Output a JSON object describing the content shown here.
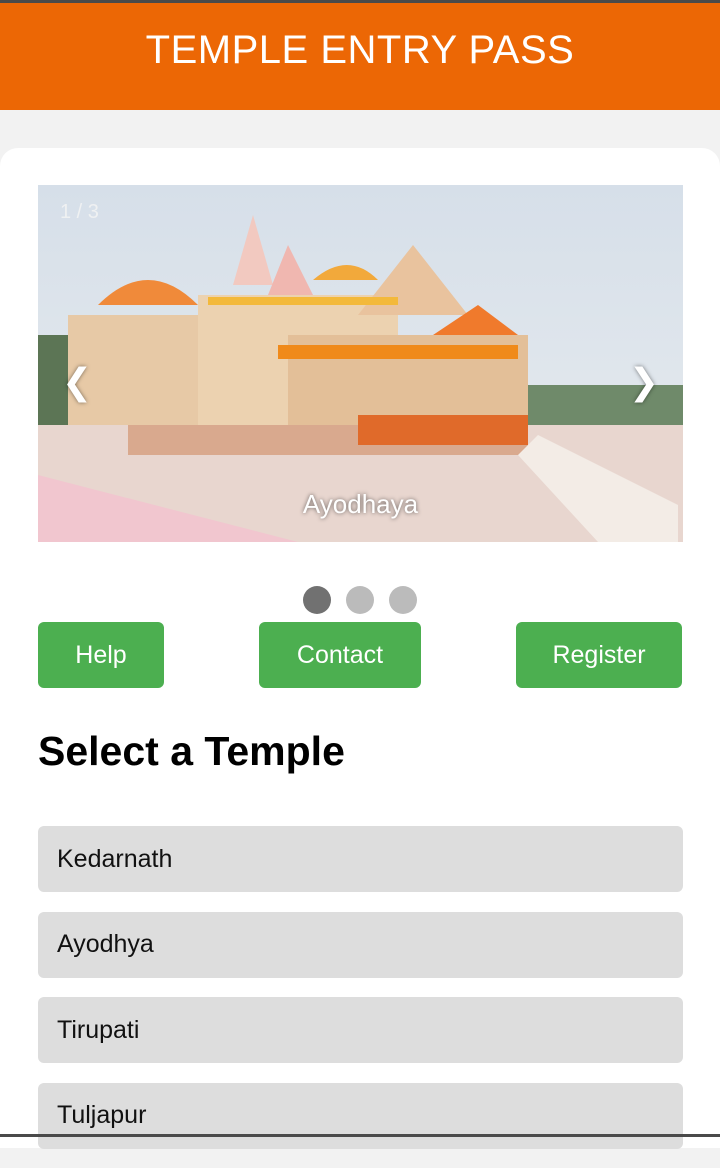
{
  "header": {
    "title": "TEMPLE ENTRY PASS"
  },
  "slideshow": {
    "counter": "1 / 3",
    "caption": "Ayodhaya",
    "prev_icon": "❮",
    "next_icon": "❯",
    "total_slides": 3,
    "active_slide": 1
  },
  "actions": {
    "help_label": "Help",
    "contact_label": "Contact",
    "register_label": "Register"
  },
  "temples_section": {
    "title": "Select a Temple",
    "items": [
      "Kedarnath",
      "Ayodhya",
      "Tirupati",
      "Tuljapur"
    ]
  },
  "colors": {
    "header_bg": "#ec6705",
    "button_bg": "#4caf50",
    "item_bg": "#dddddd",
    "dot_active": "#717171",
    "dot_inactive": "#bbbbbb"
  },
  "icons": {
    "slide_image": "temple-photo",
    "prev": "chevron-left-icon",
    "next": "chevron-right-icon"
  }
}
